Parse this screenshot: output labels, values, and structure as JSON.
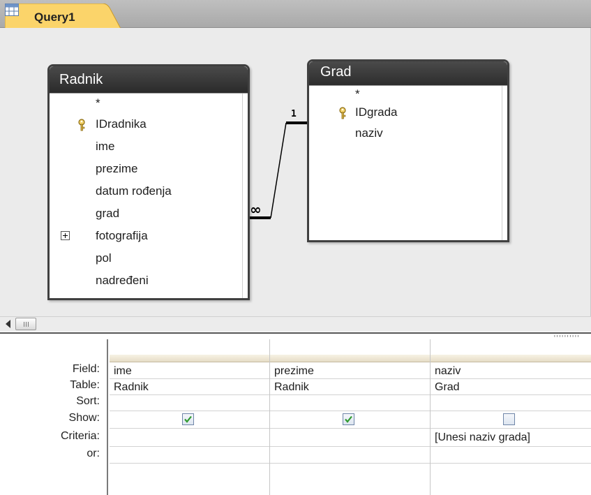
{
  "tab": {
    "title": "Query1",
    "icon": "query-icon"
  },
  "tables": [
    {
      "name": "Radnik",
      "fields": [
        {
          "label": "*"
        },
        {
          "label": "IDradnika",
          "key": true
        },
        {
          "label": "ime"
        },
        {
          "label": "prezime"
        },
        {
          "label": "datum rođenja"
        },
        {
          "label": "grad"
        },
        {
          "label": "fotografija",
          "expandable": true
        },
        {
          "label": "pol"
        },
        {
          "label": "nadređeni"
        }
      ]
    },
    {
      "name": "Grad",
      "fields": [
        {
          "label": "*"
        },
        {
          "label": "IDgrada",
          "key": true
        },
        {
          "label": "naziv"
        }
      ]
    }
  ],
  "relationship": {
    "one_label": "1",
    "many_label": "∞"
  },
  "grid": {
    "row_labels": [
      "Field:",
      "Table:",
      "Sort:",
      "Show:",
      "Criteria:",
      "or:"
    ],
    "columns": [
      {
        "field": "ime",
        "table": "Radnik",
        "sort": "",
        "show": true,
        "criteria": "",
        "or": ""
      },
      {
        "field": "prezime",
        "table": "Radnik",
        "sort": "",
        "show": true,
        "criteria": "",
        "or": ""
      },
      {
        "field": "naziv",
        "table": "Grad",
        "sort": "",
        "show": false,
        "criteria": "[Unesi naziv grada]",
        "or": ""
      }
    ]
  },
  "colors": {
    "tab_bg": "#fbd46a",
    "table_header": "#333333",
    "check": "#2f9a2f"
  }
}
